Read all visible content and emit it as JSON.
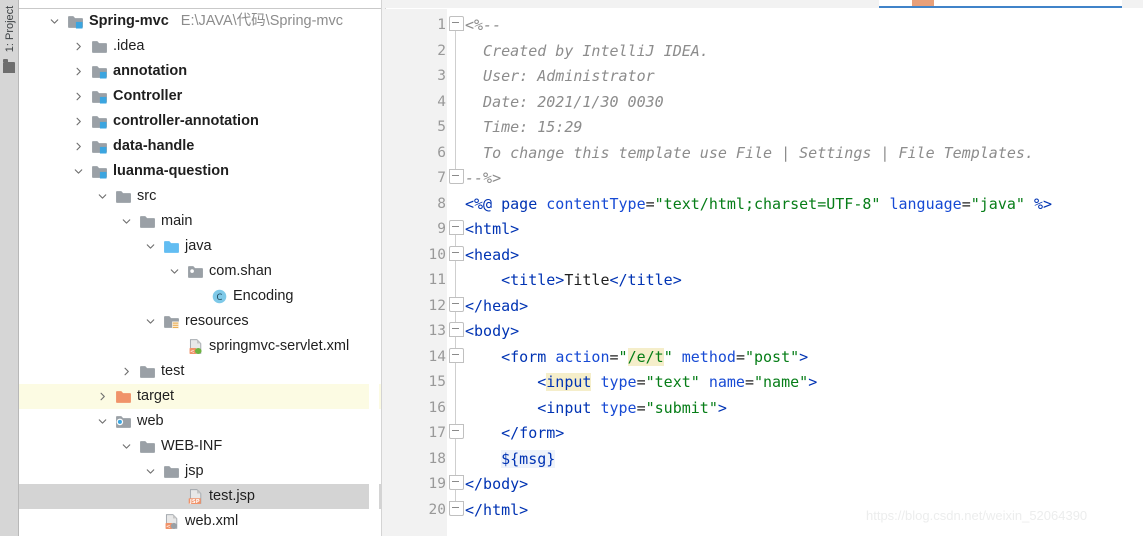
{
  "toolwindow": {
    "vertical_tab_label": "1: Project"
  },
  "project_tree": {
    "rows": [
      {
        "id": "spring-mvc",
        "label": "Spring-mvc",
        "path": "E:\\JAVA\\代码\\Spring-mvc",
        "indent": 0,
        "arrow": "down",
        "icon": "module-folder-icon",
        "bold": true,
        "state": "normal"
      },
      {
        "id": "idea",
        "label": ".idea",
        "path": "",
        "indent": 1,
        "arrow": "right",
        "icon": "folder-icon",
        "bold": false,
        "state": "normal"
      },
      {
        "id": "annotation",
        "label": "annotation",
        "path": "",
        "indent": 1,
        "arrow": "right",
        "icon": "module-folder-icon",
        "bold": true,
        "state": "normal"
      },
      {
        "id": "controller",
        "label": "Controller",
        "path": "",
        "indent": 1,
        "arrow": "right",
        "icon": "module-folder-icon",
        "bold": true,
        "state": "normal"
      },
      {
        "id": "controller-annotation",
        "label": "controller-annotation",
        "path": "",
        "indent": 1,
        "arrow": "right",
        "icon": "module-folder-icon",
        "bold": true,
        "state": "normal"
      },
      {
        "id": "data-handle",
        "label": "data-handle",
        "path": "",
        "indent": 1,
        "arrow": "right",
        "icon": "module-folder-icon",
        "bold": true,
        "state": "normal"
      },
      {
        "id": "luanma-question",
        "label": "luanma-question",
        "path": "",
        "indent": 1,
        "arrow": "down",
        "icon": "module-folder-icon",
        "bold": true,
        "state": "normal"
      },
      {
        "id": "src",
        "label": "src",
        "path": "",
        "indent": 2,
        "arrow": "down",
        "icon": "folder-icon",
        "bold": false,
        "state": "normal"
      },
      {
        "id": "main",
        "label": "main",
        "path": "",
        "indent": 3,
        "arrow": "down",
        "icon": "folder-icon",
        "bold": false,
        "state": "normal"
      },
      {
        "id": "java",
        "label": "java",
        "path": "",
        "indent": 4,
        "arrow": "down",
        "icon": "source-root-folder-icon",
        "bold": false,
        "state": "normal"
      },
      {
        "id": "com-shan",
        "label": "com.shan",
        "path": "",
        "indent": 5,
        "arrow": "down",
        "icon": "package-icon",
        "bold": false,
        "state": "normal"
      },
      {
        "id": "encoding",
        "label": "Encoding",
        "path": "",
        "indent": 6,
        "arrow": "none",
        "icon": "java-class-icon",
        "bold": false,
        "state": "normal"
      },
      {
        "id": "resources",
        "label": "resources",
        "path": "",
        "indent": 4,
        "arrow": "down",
        "icon": "resources-folder-icon",
        "bold": false,
        "state": "normal"
      },
      {
        "id": "springmvc-servlet",
        "label": "springmvc-servlet.xml",
        "path": "",
        "indent": 5,
        "arrow": "none",
        "icon": "spring-xml-file-icon",
        "bold": false,
        "state": "normal"
      },
      {
        "id": "test",
        "label": "test",
        "path": "",
        "indent": 3,
        "arrow": "right",
        "icon": "folder-icon",
        "bold": false,
        "state": "normal"
      },
      {
        "id": "target",
        "label": "target",
        "path": "",
        "indent": 2,
        "arrow": "right",
        "icon": "excluded-folder-icon",
        "bold": false,
        "state": "highlighted"
      },
      {
        "id": "web",
        "label": "web",
        "path": "",
        "indent": 2,
        "arrow": "down",
        "icon": "web-root-folder-icon",
        "bold": false,
        "state": "normal"
      },
      {
        "id": "web-inf",
        "label": "WEB-INF",
        "path": "",
        "indent": 3,
        "arrow": "down",
        "icon": "folder-icon",
        "bold": false,
        "state": "normal"
      },
      {
        "id": "jsp",
        "label": "jsp",
        "path": "",
        "indent": 4,
        "arrow": "down",
        "icon": "folder-icon",
        "bold": false,
        "state": "normal"
      },
      {
        "id": "test-jsp",
        "label": "test.jsp",
        "path": "",
        "indent": 5,
        "arrow": "none",
        "icon": "jsp-file-icon",
        "bold": false,
        "state": "selected"
      },
      {
        "id": "web-xml",
        "label": "web.xml",
        "path": "",
        "indent": 4,
        "arrow": "none",
        "icon": "xml-file-icon",
        "bold": false,
        "state": "normal"
      }
    ]
  },
  "editor": {
    "line_numbers": [
      "1",
      "2",
      "3",
      "4",
      "5",
      "6",
      "7",
      "8",
      "9",
      "10",
      "11",
      "12",
      "13",
      "14",
      "15",
      "16",
      "17",
      "18",
      "19",
      "20"
    ],
    "lines": [
      {
        "n": "1",
        "text": "<%--"
      },
      {
        "n": "2",
        "text": "  Created by IntelliJ IDEA."
      },
      {
        "n": "3",
        "text": "  User: Administrator"
      },
      {
        "n": "4",
        "text": "  Date: 2021/1/30 0030"
      },
      {
        "n": "5",
        "text": "  Time: 15:29"
      },
      {
        "n": "6",
        "text": "  To change this template use File | Settings | File Templates."
      },
      {
        "n": "7",
        "text": "--%>"
      },
      {
        "n": "8",
        "text": "<%@ page contentType=\"text/html;charset=UTF-8\" language=\"java\" %>"
      },
      {
        "n": "9",
        "text": "<html>"
      },
      {
        "n": "10",
        "text": "<head>"
      },
      {
        "n": "11",
        "text": "    <title>Title</title>"
      },
      {
        "n": "12",
        "text": "</head>"
      },
      {
        "n": "13",
        "text": "<body>"
      },
      {
        "n": "14",
        "text": "    <form action=\"/e/t\" method=\"post\">"
      },
      {
        "n": "15",
        "text": "        <input type=\"text\" name=\"name\">"
      },
      {
        "n": "16",
        "text": "        <input type=\"submit\">"
      },
      {
        "n": "17",
        "text": "    </form>"
      },
      {
        "n": "18",
        "text": "    ${msg}"
      },
      {
        "n": "19",
        "text": "</body>"
      },
      {
        "n": "20",
        "text": "</html>"
      }
    ]
  },
  "watermark": {
    "text": "https://blog.csdn.net/weixin_52064390"
  },
  "colors": {
    "selection": "#d4d4d4",
    "excluded_highlight": "#fcfbe3",
    "tab_accent": "#4083c9",
    "string": "#067d17",
    "tag": "#0033b3",
    "attribute": "#174ad4",
    "comment": "#8c8c8c",
    "search_highlight": "#f5eeca"
  }
}
